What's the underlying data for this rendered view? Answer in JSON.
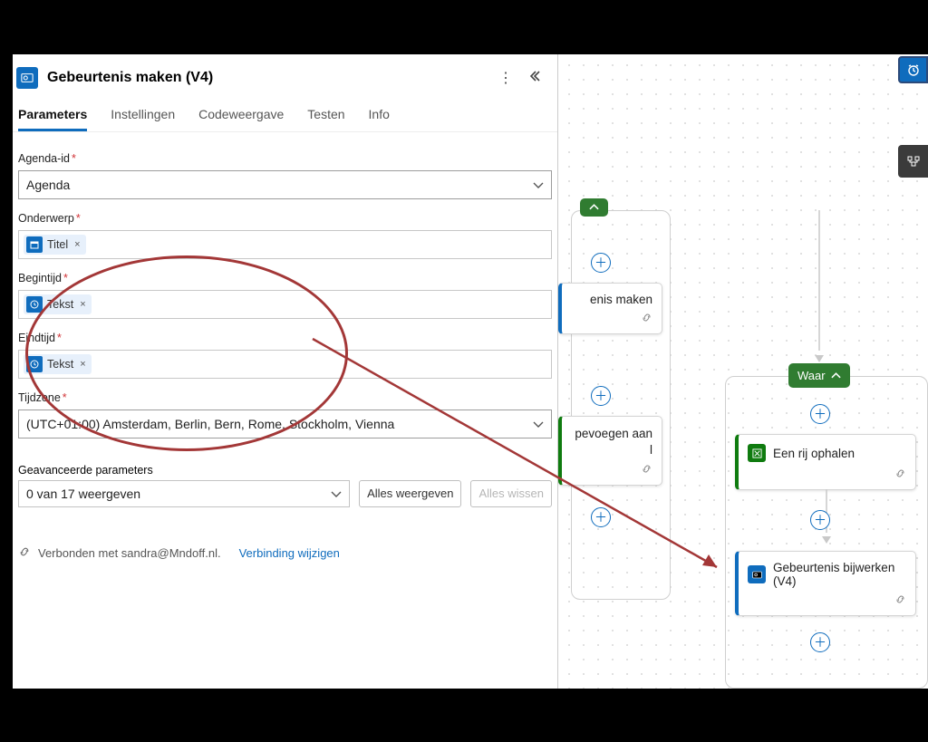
{
  "panel": {
    "title": "Gebeurtenis maken (V4)",
    "tabs": [
      "Parameters",
      "Instellingen",
      "Codeweergave",
      "Testen",
      "Info"
    ],
    "active_tab": 0,
    "fields": {
      "agenda_label": "Agenda-id",
      "agenda_value": "Agenda",
      "subject_label": "Onderwerp",
      "subject_token": "Titel",
      "start_label": "Begintijd",
      "start_token": "Tekst",
      "end_label": "Eindtijd",
      "end_token": "Tekst",
      "tz_label": "Tijdzone",
      "tz_value": "(UTC+01:00) Amsterdam, Berlin, Bern, Rome, Stockholm, Vienna"
    },
    "advanced": {
      "label": "Geavanceerde parameters",
      "dropdown": "0 van 17 weergeven",
      "show_all": "Alles weergeven",
      "clear_all": "Alles wissen"
    },
    "connection": {
      "text": "Verbonden met sandra@Mndoff.nl.",
      "change": "Verbinding wijzigen"
    }
  },
  "canvas": {
    "waar_label": "Waar",
    "card_maken": "enis maken",
    "card_toevoegen_top": "pevoegen aan",
    "card_toevoegen_bot": "l",
    "card_rij": "Een rij ophalen",
    "card_bijwerken": "Gebeurtenis bijwerken (V4)"
  }
}
